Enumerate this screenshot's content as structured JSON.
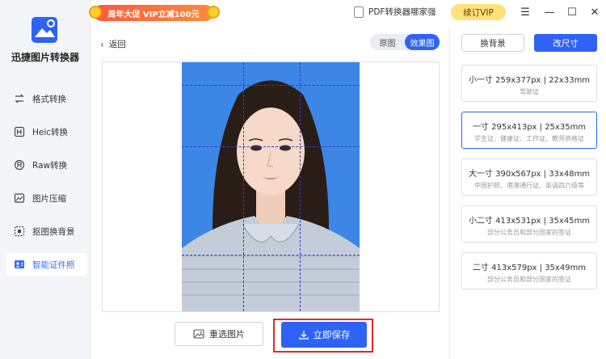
{
  "app": {
    "brand": "迅捷图片转换器"
  },
  "topbar": {
    "promo": "周年大促 VIP立减100元",
    "pdf_link": "PDF转换器哪家强",
    "vip_label": "续订VIP",
    "controls": {
      "menu": "☰",
      "minimize": "—",
      "maximize": "☐",
      "close": "✕"
    }
  },
  "sidebar": {
    "items": [
      {
        "label": "格式转换",
        "icon": "swap-icon"
      },
      {
        "label": "Heic转换",
        "icon": "heic-icon"
      },
      {
        "label": "Raw转换",
        "icon": "raw-icon"
      },
      {
        "label": "图片压缩",
        "icon": "compress-icon"
      },
      {
        "label": "抠图换背景",
        "icon": "cutout-icon"
      },
      {
        "label": "智能证件照",
        "icon": "id-photo-icon",
        "active": true
      }
    ]
  },
  "main": {
    "back_label": "返回",
    "toggle": {
      "original": "原图",
      "effect": "效果图",
      "selected": "effect"
    },
    "reselect_label": "重选图片",
    "save_label": "立即保存"
  },
  "right_panel": {
    "change_bg": "换背景",
    "change_size": "改尺寸",
    "sizes": [
      {
        "title": "小一寸 259x377px | 22x33mm",
        "desc": "驾驶证"
      },
      {
        "title": "一寸 295x413px | 25x35mm",
        "desc": "学生证、健康证、工作证、教师资格证",
        "selected": true
      },
      {
        "title": "大一寸 390x567px | 33x48mm",
        "desc": "中国护照、港澳通行证、英语四六级等"
      },
      {
        "title": "小二寸 413x531px | 35x45mm",
        "desc": "部分公务员和部分国家的签证"
      },
      {
        "title": "二寸 413x579px | 35x49mm",
        "desc": "部分公务员和部分国家的签证"
      }
    ]
  },
  "colors": {
    "accent": "#2f63f6",
    "photo_bg": "#3c86e6",
    "highlight": "#e02b2b",
    "vip": "#ffe27a"
  }
}
